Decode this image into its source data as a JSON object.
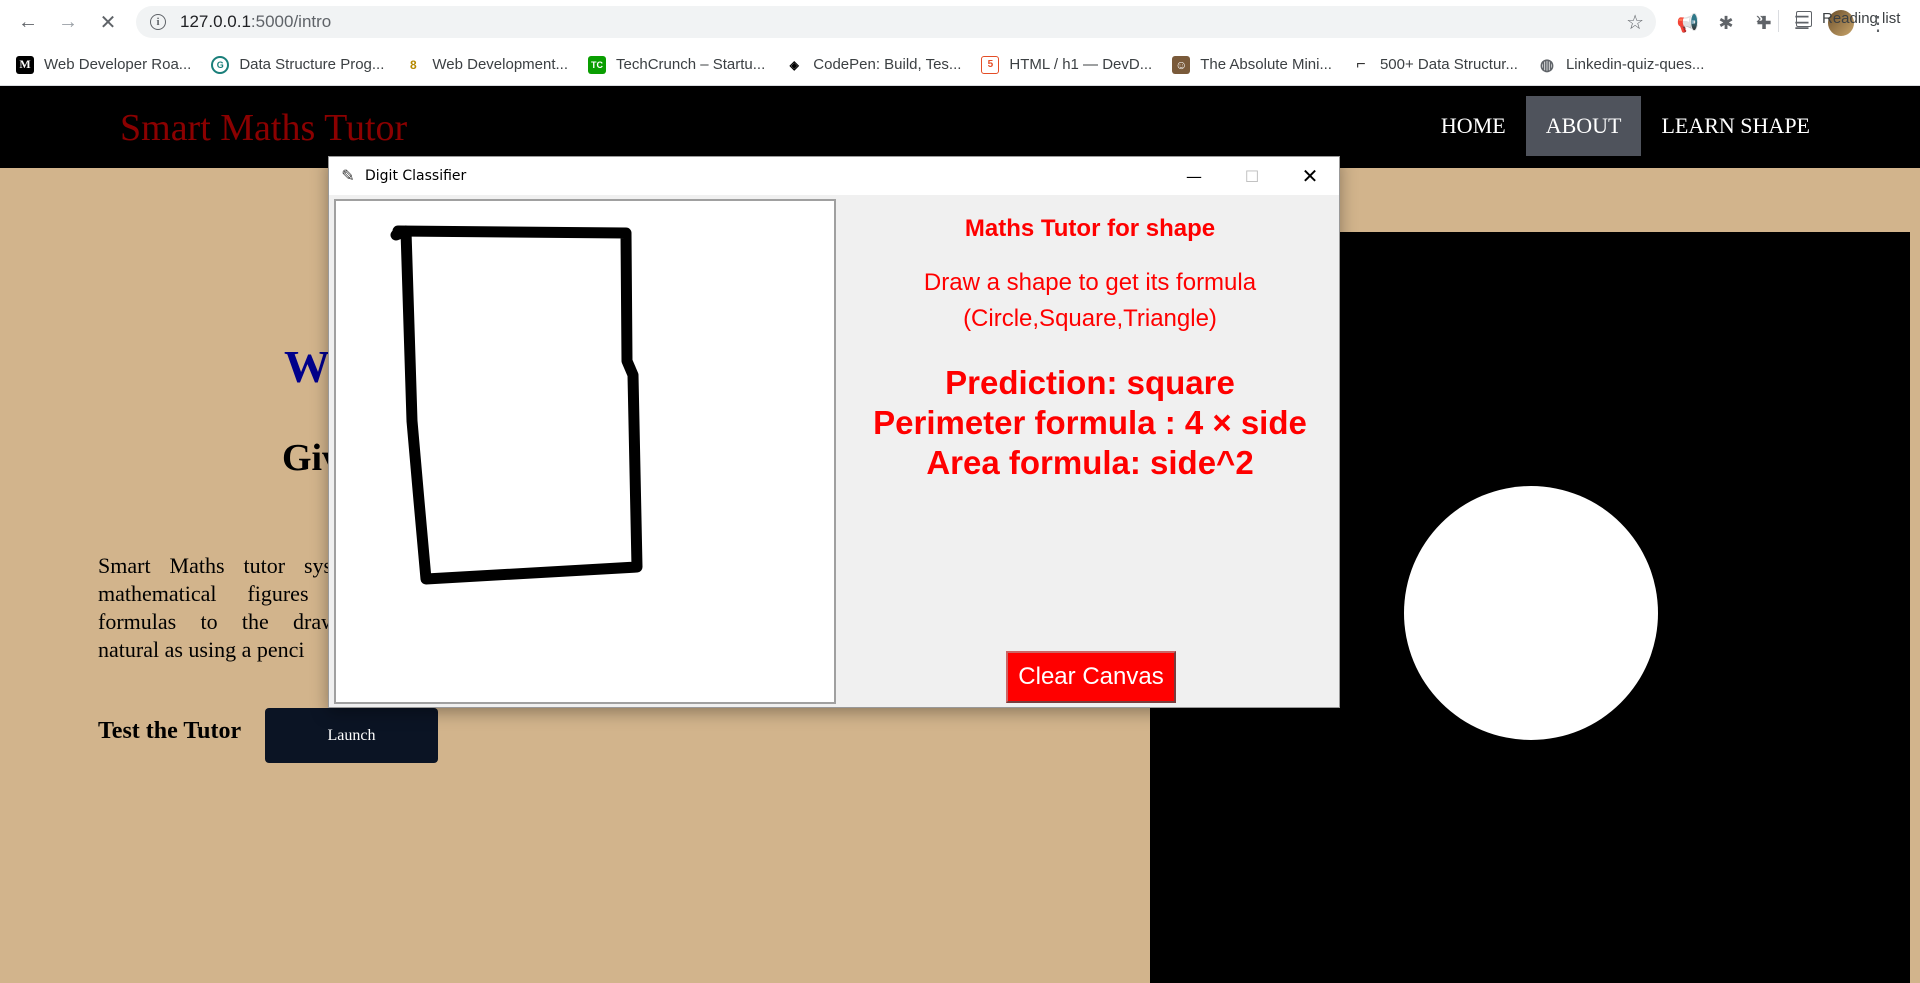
{
  "browser": {
    "url_host": "127.0.0.1",
    "url_path": ":5000/intro",
    "bookmarks": [
      {
        "label": "Web Developer Roa...",
        "fav": "M"
      },
      {
        "label": "Data Structure Prog...",
        "fav": "G"
      },
      {
        "label": "Web Development...",
        "fav": "8"
      },
      {
        "label": "TechCrunch – Startu...",
        "fav": "TC"
      },
      {
        "label": "CodePen: Build, Tes...",
        "fav": "◈"
      },
      {
        "label": "HTML / h1 — DevD...",
        "fav": "5"
      },
      {
        "label": "The Absolute Mini...",
        "fav": "☺"
      },
      {
        "label": "500+ Data Structur...",
        "fav": "⌐"
      },
      {
        "label": "Linkedin-quiz-ques...",
        "fav": "◍"
      }
    ],
    "more": "»",
    "reading_list": "Reading list"
  },
  "site": {
    "brand": "Smart Maths Tutor",
    "nav": [
      "HOME",
      "ABOUT",
      "LEARN SHAPE"
    ],
    "active_nav": "ABOUT",
    "heading_partial": "W",
    "subheading_partial": "Giv",
    "paragraph_partial": "Smart Maths tutor syste mathematical figures s formulas to the drawn natural as using a penci",
    "test_label": "Test the Tutor",
    "launch_label": "Launch"
  },
  "tk_window": {
    "title": "Digit Classifier",
    "heading": "Maths Tutor for shape",
    "instruction_line1": "Draw a shape to get its formula",
    "instruction_line2": "(Circle,Square,Triangle)",
    "prediction": "Prediction: square",
    "perimeter": "Perimeter formula : 4 × side",
    "area": "Area formula: side^2",
    "clear_label": "Clear Canvas"
  },
  "colors": {
    "page_bg": "#d2b48c",
    "brand": "#8b0000",
    "accent_text": "#ff0000",
    "launch_bg": "#0b1424"
  }
}
